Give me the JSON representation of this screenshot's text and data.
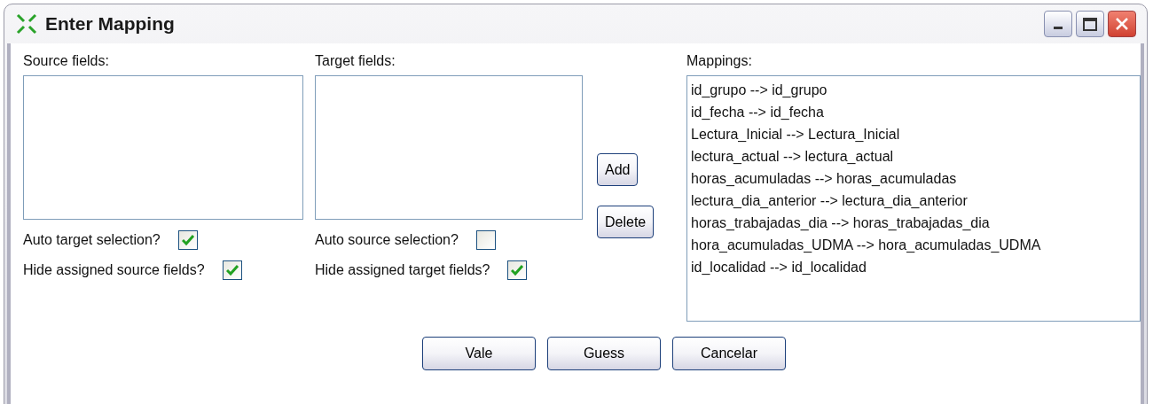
{
  "window": {
    "title": "Enter Mapping"
  },
  "source": {
    "label": "Source fields:",
    "options": [
      {
        "label": "Auto target selection?",
        "checked": true
      },
      {
        "label": "Hide assigned source fields?",
        "checked": true
      }
    ]
  },
  "target": {
    "label": "Target fields:",
    "options": [
      {
        "label": "Auto source selection?",
        "checked": false
      },
      {
        "label": "Hide assigned target fields?",
        "checked": true
      }
    ]
  },
  "side_buttons": [
    "Add",
    "Delete"
  ],
  "mappings": {
    "label": "Mappings:",
    "items": [
      "id_grupo --> id_grupo",
      "id_fecha --> id_fecha",
      "Lectura_Inicial --> Lectura_Inicial",
      "lectura_actual --> lectura_actual",
      "horas_acumuladas --> horas_acumuladas",
      "lectura_dia_anterior --> lectura_dia_anterior",
      "horas_trabajadas_dia --> horas_trabajadas_dia",
      "hora_acumuladas_UDMA --> hora_acumuladas_UDMA",
      "id_localidad --> id_localidad"
    ]
  },
  "buttons": [
    "Vale",
    "Guess",
    "Cancelar"
  ]
}
